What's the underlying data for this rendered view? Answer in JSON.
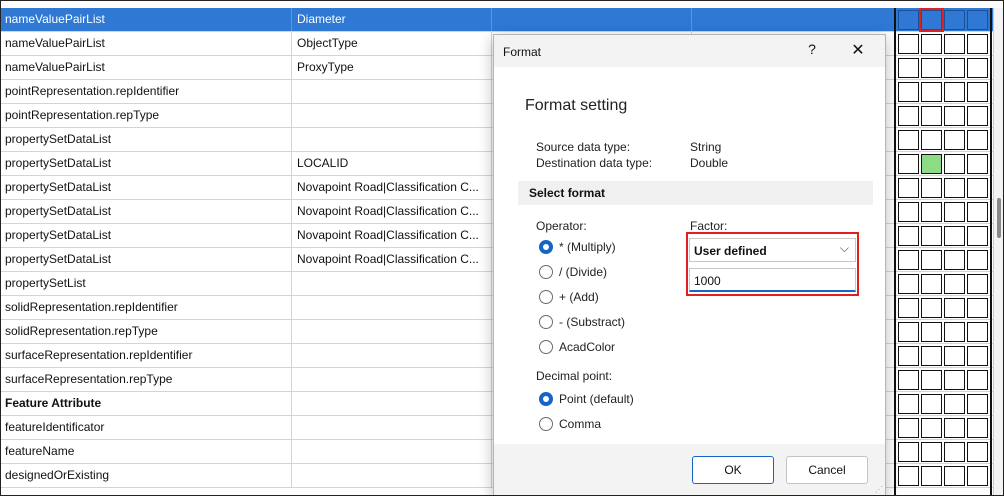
{
  "grid": {
    "rows": [
      {
        "name": "nameValuePairList",
        "value": "Diameter",
        "selected": true
      },
      {
        "name": "nameValuePairList",
        "value": "ObjectType"
      },
      {
        "name": "nameValuePairList",
        "value": "ProxyType"
      },
      {
        "name": "pointRepresentation.repIdentifier",
        "value": ""
      },
      {
        "name": "pointRepresentation.repType",
        "value": ""
      },
      {
        "name": "propertySetDataList",
        "value": ""
      },
      {
        "name": "propertySetDataList",
        "value": "LOCALID"
      },
      {
        "name": "propertySetDataList",
        "value": "Novapoint Road|Classification C..."
      },
      {
        "name": "propertySetDataList",
        "value": "Novapoint Road|Classification C..."
      },
      {
        "name": "propertySetDataList",
        "value": "Novapoint Road|Classification C..."
      },
      {
        "name": "propertySetDataList",
        "value": "Novapoint Road|Classification C..."
      },
      {
        "name": "propertySetList",
        "value": ""
      },
      {
        "name": "solidRepresentation.repIdentifier",
        "value": ""
      },
      {
        "name": "solidRepresentation.repType",
        "value": ""
      },
      {
        "name": "surfaceRepresentation.repIdentifier",
        "value": ""
      },
      {
        "name": "surfaceRepresentation.repType",
        "value": ""
      },
      {
        "name": "Feature Attribute",
        "value": "",
        "bold": true
      },
      {
        "name": "featureIdentificator",
        "value": ""
      },
      {
        "name": "featureName",
        "value": ""
      },
      {
        "name": "designedOrExisting",
        "value": ""
      }
    ]
  },
  "dialog": {
    "title": "Format",
    "help": "?",
    "close": "✕",
    "heading": "Format setting",
    "source_label": "Source data type:",
    "source_value": "String",
    "dest_label": "Destination data type:",
    "dest_value": "Double",
    "select_format": "Select format",
    "operator_label": "Operator:",
    "operators": [
      {
        "label": "* (Multiply)",
        "checked": true
      },
      {
        "label": "/ (Divide)",
        "checked": false
      },
      {
        "label": "+ (Add)",
        "checked": false
      },
      {
        "label": "- (Substract)",
        "checked": false
      },
      {
        "label": "AcadColor",
        "checked": false
      }
    ],
    "decimal_label": "Decimal point:",
    "decimals": [
      {
        "label": "Point (default)",
        "checked": true
      },
      {
        "label": "Comma",
        "checked": false
      }
    ],
    "factor_label": "Factor:",
    "factor_select": "User defined",
    "factor_value": "1000",
    "ok": "OK",
    "cancel": "Cancel"
  },
  "colors": {
    "selection": "#2f78d4",
    "highlight": "#e02020",
    "checked_green": "#8edb87"
  }
}
